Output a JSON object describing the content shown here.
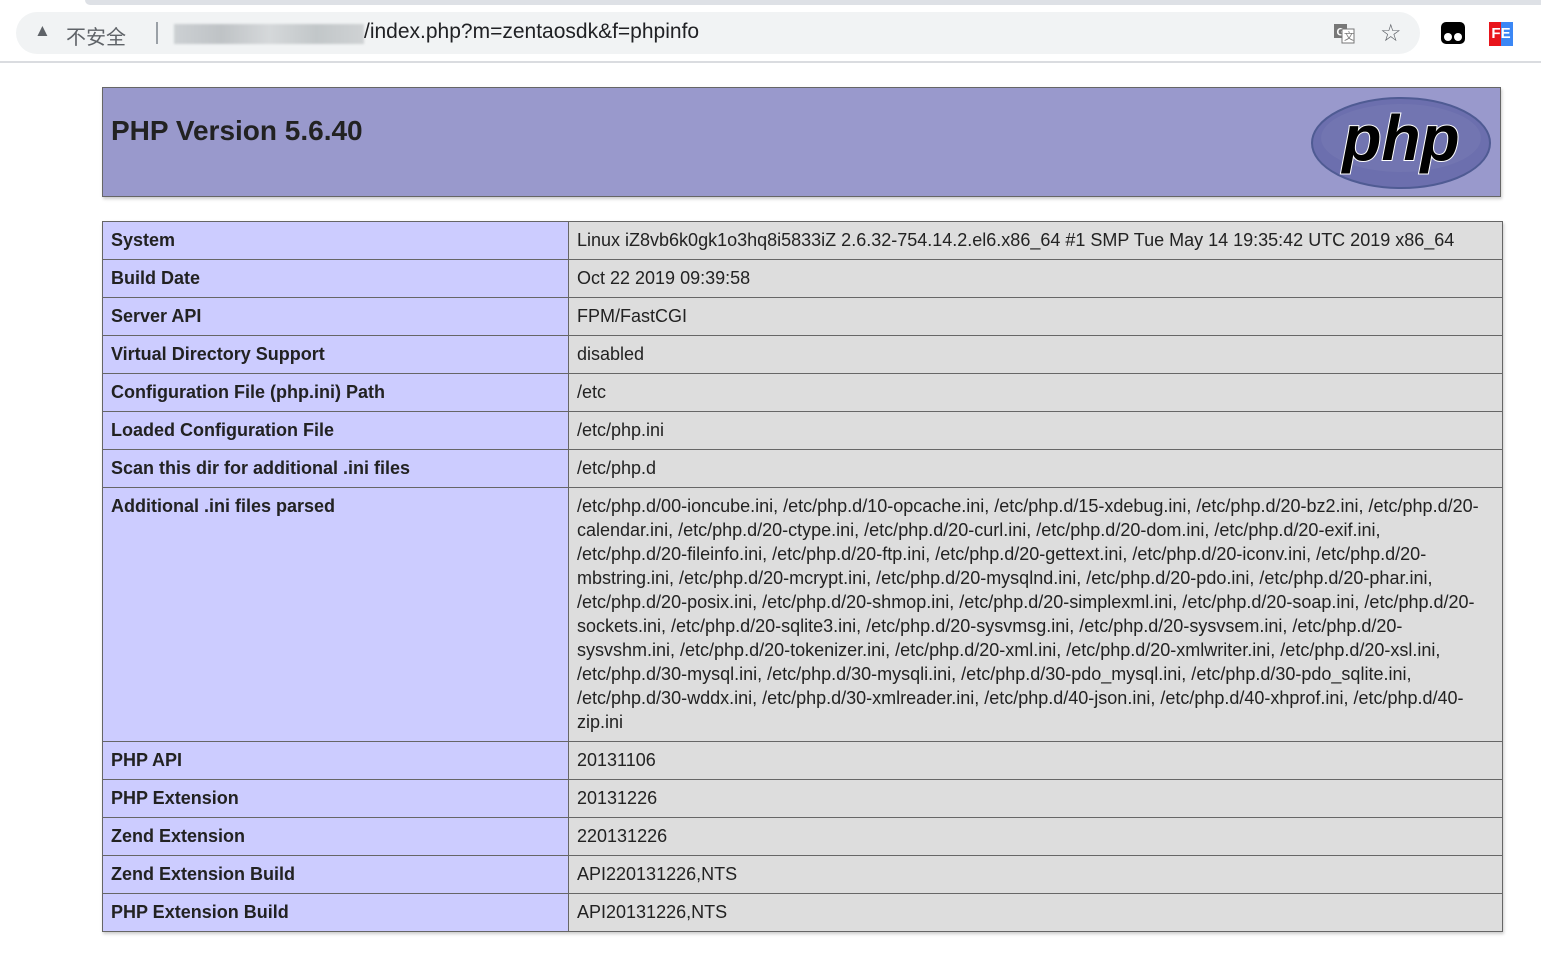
{
  "browser": {
    "security_label": "不安全",
    "url": "/index.php?m=zentaosdk&f=phpinfo"
  },
  "header": {
    "title": "PHP Version 5.6.40",
    "logo_text": "php"
  },
  "rows": [
    {
      "label": "System",
      "value": "Linux iZ8vb6k0gk1o3hq8i5833iZ 2.6.32-754.14.2.el6.x86_64 #1 SMP Tue May 14 19:35:42 UTC 2019 x86_64"
    },
    {
      "label": "Build Date",
      "value": "Oct 22 2019 09:39:58"
    },
    {
      "label": "Server API",
      "value": "FPM/FastCGI"
    },
    {
      "label": "Virtual Directory Support",
      "value": "disabled"
    },
    {
      "label": "Configuration File (php.ini) Path",
      "value": "/etc"
    },
    {
      "label": "Loaded Configuration File",
      "value": "/etc/php.ini"
    },
    {
      "label": "Scan this dir for additional .ini files",
      "value": "/etc/php.d"
    },
    {
      "label": "Additional .ini files parsed",
      "value": "/etc/php.d/00-ioncube.ini, /etc/php.d/10-opcache.ini, /etc/php.d/15-xdebug.ini, /etc/php.d/20-bz2.ini, /etc/php.d/20-calendar.ini, /etc/php.d/20-ctype.ini, /etc/php.d/20-curl.ini, /etc/php.d/20-dom.ini, /etc/php.d/20-exif.ini, /etc/php.d/20-fileinfo.ini, /etc/php.d/20-ftp.ini, /etc/php.d/20-gettext.ini, /etc/php.d/20-iconv.ini, /etc/php.d/20-mbstring.ini, /etc/php.d/20-mcrypt.ini, /etc/php.d/20-mysqlnd.ini, /etc/php.d/20-pdo.ini, /etc/php.d/20-phar.ini, /etc/php.d/20-posix.ini, /etc/php.d/20-shmop.ini, /etc/php.d/20-simplexml.ini, /etc/php.d/20-soap.ini, /etc/php.d/20-sockets.ini, /etc/php.d/20-sqlite3.ini, /etc/php.d/20-sysvmsg.ini, /etc/php.d/20-sysvsem.ini, /etc/php.d/20-sysvshm.ini, /etc/php.d/20-tokenizer.ini, /etc/php.d/20-xml.ini, /etc/php.d/20-xmlwriter.ini, /etc/php.d/20-xsl.ini, /etc/php.d/30-mysql.ini, /etc/php.d/30-mysqli.ini, /etc/php.d/30-pdo_mysql.ini, /etc/php.d/30-pdo_sqlite.ini, /etc/php.d/30-wddx.ini, /etc/php.d/30-xmlreader.ini, /etc/php.d/40-json.ini, /etc/php.d/40-xhprof.ini, /etc/php.d/40-zip.ini"
    },
    {
      "label": "PHP API",
      "value": "20131106"
    },
    {
      "label": "PHP Extension",
      "value": "20131226"
    },
    {
      "label": "Zend Extension",
      "value": "220131226"
    },
    {
      "label": "Zend Extension Build",
      "value": "API220131226,NTS"
    },
    {
      "label": "PHP Extension Build",
      "value": "API20131226,NTS"
    }
  ]
}
